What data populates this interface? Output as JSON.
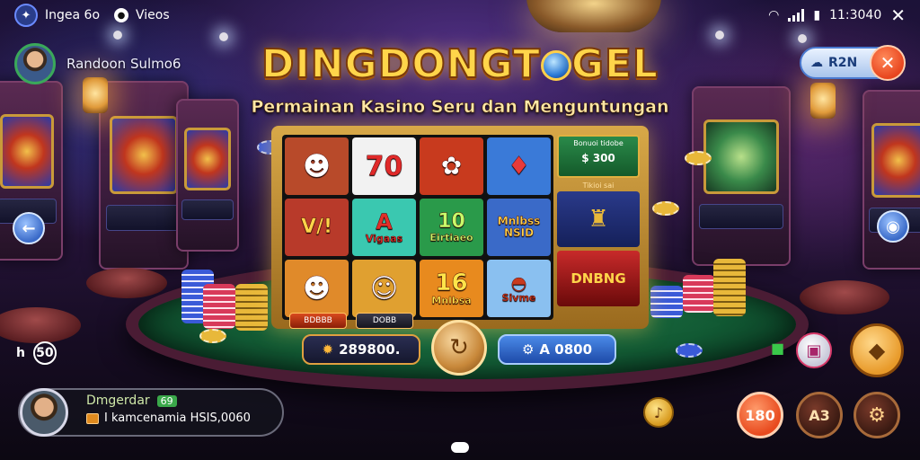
{
  "status_bar": {
    "left_label": "Ingea 6o",
    "left_label2": "Vieos",
    "time": "11:3040"
  },
  "header": {
    "profile_name": "Randoon Sulmo6",
    "logo_text_1": "DINGDONGT",
    "logo_text_2": "GEL",
    "tagline": "Permainan Kasino Seru dan Menguntungan",
    "top_button_label": "R2N"
  },
  "slot": {
    "reels": [
      {
        "text": "",
        "color": "#c8502a"
      },
      {
        "text": "70",
        "color": "#f0f0f0"
      },
      {
        "text": "",
        "color": "#c83a1e"
      },
      {
        "text": "",
        "color": "#3a7ad8"
      },
      {
        "text": "V/!",
        "color": "#b83a2a"
      },
      {
        "text": "A",
        "label": "Vigaas",
        "color": "#3ac8b0"
      },
      {
        "text": "10",
        "label": "Eirtiaeo",
        "color": "#2a9a4a"
      },
      {
        "text": "",
        "label": "Mnlbss NSID",
        "color": "#3a6ac8"
      },
      {
        "text": "",
        "color": "#e08a2a"
      },
      {
        "text": "",
        "color": "#e0a030"
      },
      {
        "text": "16",
        "label": "Mnlbsa",
        "color": "#e88a1e"
      },
      {
        "text": "",
        "label": "Sivme",
        "color": "#8ac0f0"
      }
    ],
    "info_card_title": "Bonuoi tidobe",
    "info_card_amount": "$ 300",
    "info_section_title": "Tikioi sai",
    "info_item_3": "DNBNG",
    "badge_1": "BDBBB",
    "badge_2": "DOBB"
  },
  "controls": {
    "balance": "289800.",
    "bet": "A 0800"
  },
  "player": {
    "name": "Dmgerdar",
    "level": "69",
    "line": "I kamcenamia HSIS,0060"
  },
  "left_counter": {
    "label": "h",
    "value": "50"
  },
  "bottom_right": {
    "btn_1": "180",
    "btn_2": "A3"
  },
  "colors": {
    "accent_gold": "#ffd54a",
    "table_green": "#1f7a4a",
    "close_red": "#e8451e",
    "bet_blue": "#1e4aa8"
  }
}
